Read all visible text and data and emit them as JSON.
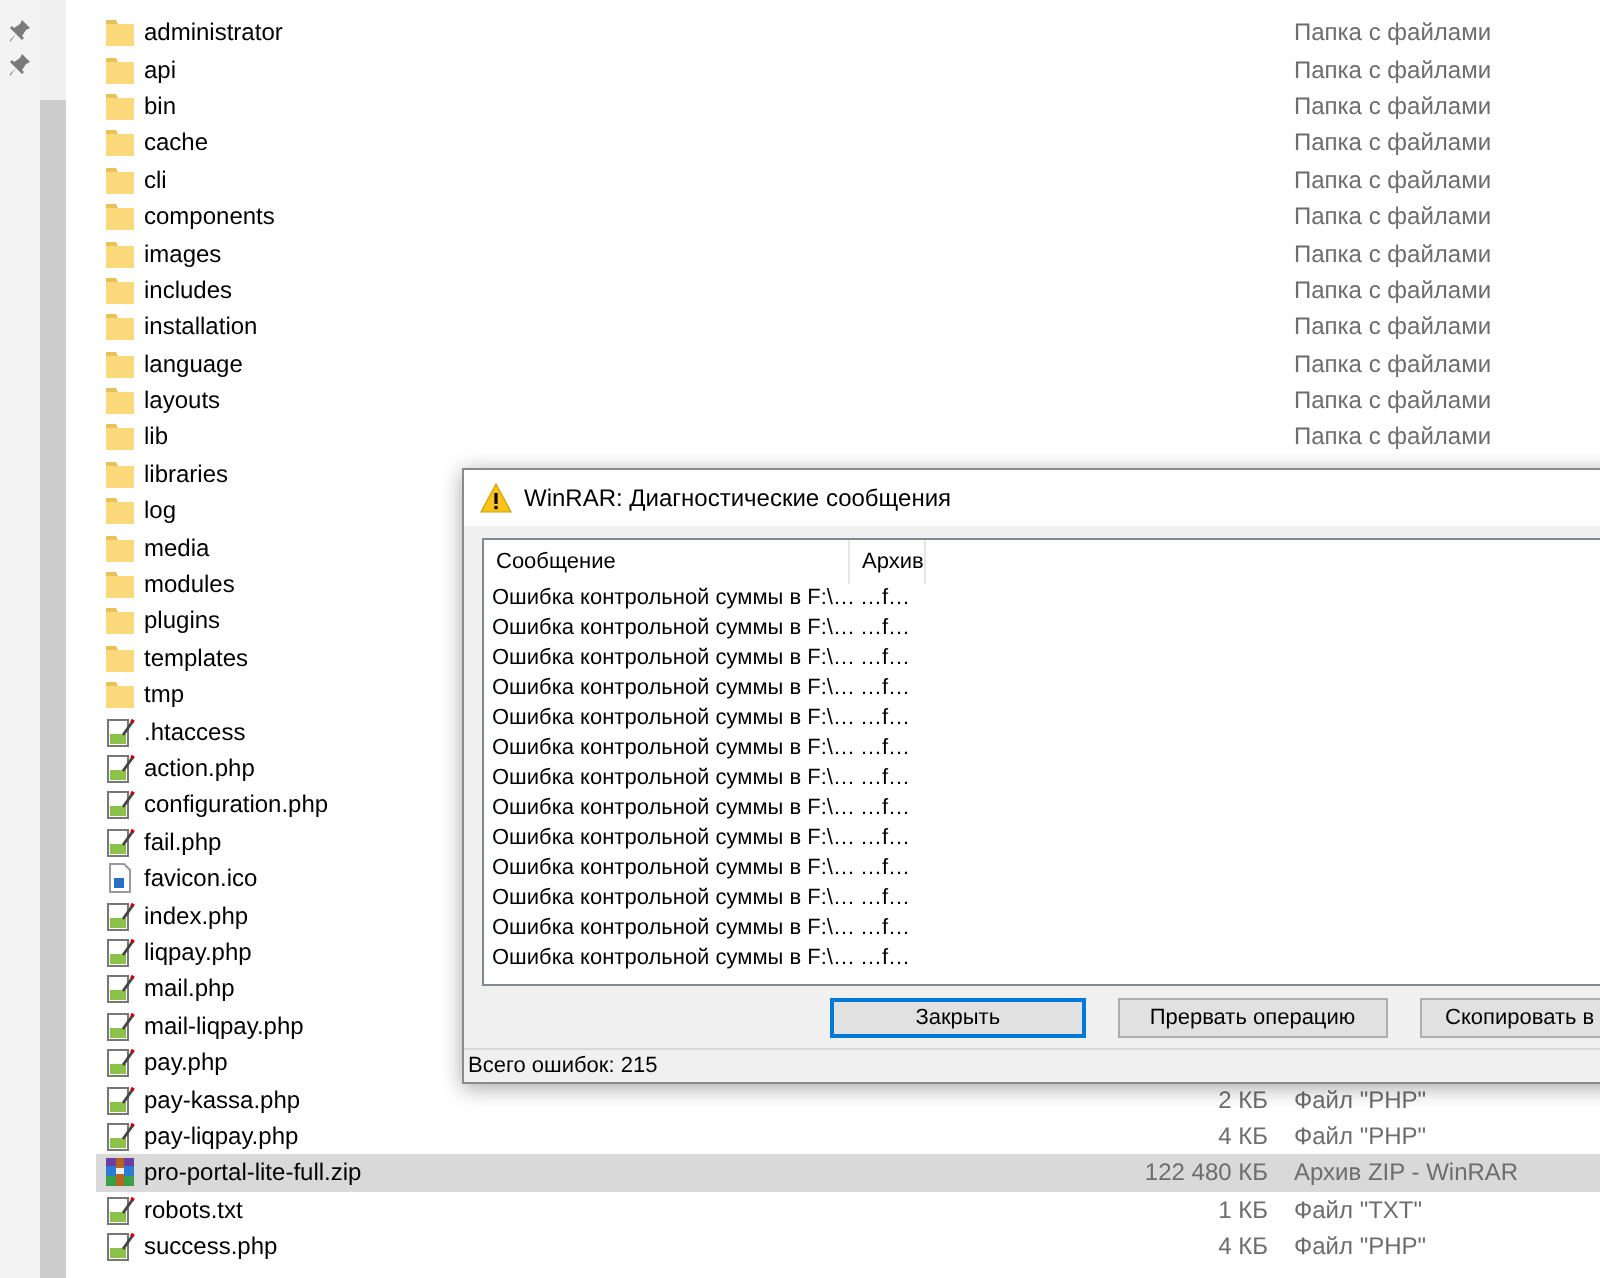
{
  "files": [
    {
      "name": "administrator",
      "kind": "folder",
      "type": "Папка с файлами",
      "selected": false
    },
    {
      "name": "api",
      "kind": "folder",
      "type": "Папка с файлами",
      "selected": false
    },
    {
      "name": "bin",
      "kind": "folder",
      "type": "Папка с файлами",
      "selected": false
    },
    {
      "name": "cache",
      "kind": "folder",
      "type": "Папка с файлами",
      "selected": false
    },
    {
      "name": "cli",
      "kind": "folder",
      "type": "Папка с файлами",
      "selected": false
    },
    {
      "name": "components",
      "kind": "folder",
      "type": "Папка с файлами",
      "selected": false
    },
    {
      "name": "images",
      "kind": "folder",
      "type": "Папка с файлами",
      "selected": false
    },
    {
      "name": "includes",
      "kind": "folder",
      "type": "Папка с файлами",
      "selected": false
    },
    {
      "name": "installation",
      "kind": "folder",
      "type": "Папка с файлами",
      "selected": false
    },
    {
      "name": "language",
      "kind": "folder",
      "type": "Папка с файлами",
      "selected": false
    },
    {
      "name": "layouts",
      "kind": "folder",
      "type": "Папка с файлами",
      "selected": false
    },
    {
      "name": "lib",
      "kind": "folder",
      "type": "Папка с файлами",
      "selected": false
    },
    {
      "name": "libraries",
      "kind": "folder",
      "selected": false
    },
    {
      "name": "log",
      "kind": "folder",
      "selected": false
    },
    {
      "name": "media",
      "kind": "folder",
      "selected": false
    },
    {
      "name": "modules",
      "kind": "folder",
      "selected": false
    },
    {
      "name": "plugins",
      "kind": "folder",
      "selected": false
    },
    {
      "name": "templates",
      "kind": "folder",
      "selected": false
    },
    {
      "name": "tmp",
      "kind": "folder",
      "selected": false
    },
    {
      "name": ".htaccess",
      "kind": "script",
      "selected": false
    },
    {
      "name": "action.php",
      "kind": "script",
      "selected": false
    },
    {
      "name": "configuration.php",
      "kind": "script",
      "selected": false
    },
    {
      "name": "fail.php",
      "kind": "script",
      "selected": false
    },
    {
      "name": "favicon.ico",
      "kind": "image",
      "selected": false
    },
    {
      "name": "index.php",
      "kind": "script",
      "selected": false
    },
    {
      "name": "liqpay.php",
      "kind": "script",
      "selected": false
    },
    {
      "name": "mail.php",
      "kind": "script",
      "selected": false
    },
    {
      "name": "mail-liqpay.php",
      "kind": "script",
      "selected": false
    },
    {
      "name": "pay.php",
      "kind": "script",
      "selected": false
    },
    {
      "name": "pay-kassa.php",
      "kind": "script",
      "size": "2 КБ",
      "type": "Файл \"PHP\"",
      "selected": false
    },
    {
      "name": "pay-liqpay.php",
      "kind": "script",
      "size": "4 КБ",
      "type": "Файл \"PHP\"",
      "selected": false
    },
    {
      "name": "pro-portal-lite-full.zip",
      "kind": "archive",
      "size": "122 480 КБ",
      "type": "Архив ZIP - WinRAR",
      "selected": true
    },
    {
      "name": "robots.txt",
      "kind": "script",
      "size": "1 КБ",
      "type": "Файл \"TXT\"",
      "selected": false
    },
    {
      "name": "success.php",
      "kind": "script",
      "size": "4 КБ",
      "type": "Файл \"PHP\"",
      "selected": false
    }
  ],
  "dialog": {
    "title": "WinRAR: Диагностические сообщения",
    "columns": [
      "Сообщение",
      "Архив"
    ],
    "rows": [
      {
        "message": "Ошибка контрольной суммы в F:\\…",
        "archive": "…f…"
      },
      {
        "message": "Ошибка контрольной суммы в F:\\…",
        "archive": "…f…"
      },
      {
        "message": "Ошибка контрольной суммы в F:\\…",
        "archive": "…f…"
      },
      {
        "message": "Ошибка контрольной суммы в F:\\…",
        "archive": "…f…"
      },
      {
        "message": "Ошибка контрольной суммы в F:\\…",
        "archive": "…f…"
      },
      {
        "message": "Ошибка контрольной суммы в F:\\…",
        "archive": "…f…"
      },
      {
        "message": "Ошибка контрольной суммы в F:\\…",
        "archive": "…f…"
      },
      {
        "message": "Ошибка контрольной суммы в F:\\…",
        "archive": "…f…"
      },
      {
        "message": "Ошибка контрольной суммы в F:\\…",
        "archive": "…f…"
      },
      {
        "message": "Ошибка контрольной суммы в F:\\…",
        "archive": "…f…"
      },
      {
        "message": "Ошибка контрольной суммы в F:\\…",
        "archive": "…f…"
      },
      {
        "message": "Ошибка контрольной суммы в F:\\…",
        "archive": "…f…"
      },
      {
        "message": "Ошибка контрольной суммы в F:\\…",
        "archive": "…f…"
      }
    ],
    "buttons": [
      {
        "label": "Закрыть",
        "focused": true
      },
      {
        "label": "Прервать операцию",
        "focused": false
      },
      {
        "label": "Скопировать в",
        "focused": false
      }
    ],
    "status": "Всего ошибок: 215"
  }
}
